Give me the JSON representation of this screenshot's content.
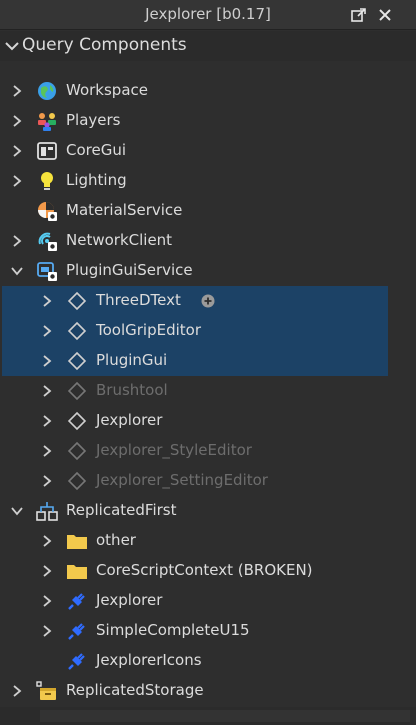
{
  "window": {
    "title": "Jexplorer [b0.17]",
    "popout_icon": "popout-icon",
    "close_icon": "close-icon"
  },
  "section": {
    "label": "Query Components"
  },
  "colors": {
    "selection": "#1c4266",
    "background": "#2e2e2e",
    "folder": "#f2c94c",
    "plugin": "#2f6bff"
  },
  "tree": [
    {
      "label": "Workspace",
      "icon": "globe-icon",
      "level": 0,
      "expander": "collapsed",
      "selected": false,
      "dim": false
    },
    {
      "label": "Players",
      "icon": "players-icon",
      "level": 0,
      "expander": "collapsed",
      "selected": false,
      "dim": false
    },
    {
      "label": "CoreGui",
      "icon": "coregui-icon",
      "level": 0,
      "expander": "collapsed",
      "selected": false,
      "dim": false
    },
    {
      "label": "Lighting",
      "icon": "lightbulb-icon",
      "level": 0,
      "expander": "collapsed",
      "selected": false,
      "dim": false
    },
    {
      "label": "MaterialService",
      "icon": "material-icon",
      "level": 0,
      "expander": "none",
      "selected": false,
      "dim": false
    },
    {
      "label": "NetworkClient",
      "icon": "network-icon",
      "level": 0,
      "expander": "collapsed",
      "selected": false,
      "dim": false
    },
    {
      "label": "PluginGuiService",
      "icon": "plugingui-service-icon",
      "level": 0,
      "expander": "expanded",
      "selected": false,
      "dim": false
    },
    {
      "label": "ThreeDText",
      "icon": "diamond-icon",
      "level": 1,
      "expander": "collapsed",
      "selected": true,
      "dim": false,
      "add_button": true
    },
    {
      "label": "ToolGripEditor",
      "icon": "diamond-icon",
      "level": 1,
      "expander": "collapsed",
      "selected": true,
      "dim": false
    },
    {
      "label": "PluginGui",
      "icon": "diamond-icon",
      "level": 1,
      "expander": "collapsed",
      "selected": true,
      "dim": false
    },
    {
      "label": "Brushtool",
      "icon": "diamond-icon",
      "level": 1,
      "expander": "collapsed",
      "selected": false,
      "dim": true
    },
    {
      "label": "Jexplorer",
      "icon": "diamond-icon",
      "level": 1,
      "expander": "collapsed",
      "selected": false,
      "dim": false
    },
    {
      "label": "Jexplorer_StyleEditor",
      "icon": "diamond-icon",
      "level": 1,
      "expander": "collapsed",
      "selected": false,
      "dim": true
    },
    {
      "label": "Jexplorer_SettingEditor",
      "icon": "diamond-icon",
      "level": 1,
      "expander": "collapsed",
      "selected": false,
      "dim": true
    },
    {
      "label": "ReplicatedFirst",
      "icon": "replicated-first-icon",
      "level": 0,
      "expander": "expanded",
      "selected": false,
      "dim": false
    },
    {
      "label": "other",
      "icon": "folder-icon",
      "level": 1,
      "expander": "collapsed",
      "selected": false,
      "dim": false
    },
    {
      "label": "CoreScriptContext (BROKEN)",
      "icon": "folder-icon",
      "level": 1,
      "expander": "collapsed",
      "selected": false,
      "dim": false
    },
    {
      "label": "Jexplorer",
      "icon": "plugin-icon",
      "level": 1,
      "expander": "collapsed",
      "selected": false,
      "dim": false
    },
    {
      "label": "SimpleCompleteU15",
      "icon": "plugin-icon",
      "level": 1,
      "expander": "collapsed",
      "selected": false,
      "dim": false
    },
    {
      "label": "JexplorerIcons",
      "icon": "plugin-icon",
      "level": 1,
      "expander": "none",
      "selected": false,
      "dim": false
    },
    {
      "label": "ReplicatedStorage",
      "icon": "replicated-storage-icon",
      "level": 0,
      "expander": "collapsed",
      "selected": false,
      "dim": false
    }
  ]
}
